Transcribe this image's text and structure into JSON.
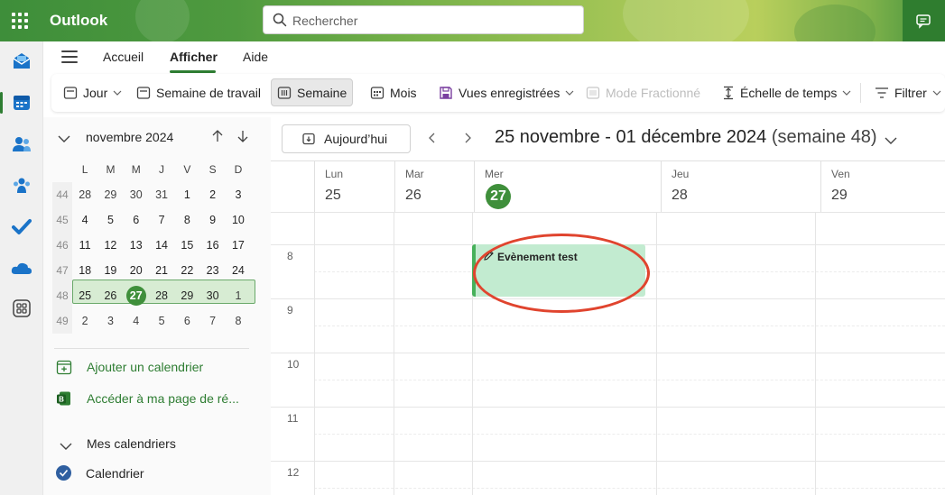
{
  "header": {
    "app_title": "Outlook",
    "search_placeholder": "Rechercher"
  },
  "nav_tabs": [
    {
      "label": "Accueil",
      "active": false
    },
    {
      "label": "Afficher",
      "active": true
    },
    {
      "label": "Aide",
      "active": false
    }
  ],
  "ribbon": {
    "day": "Jour",
    "work_week": "Semaine de travail",
    "week": "Semaine",
    "month": "Mois",
    "saved_views": "Vues enregistrées",
    "split_mode": "Mode Fractionné",
    "time_scale": "Échelle de temps",
    "filter": "Filtrer"
  },
  "mini_calendar": {
    "month_label": "novembre 2024",
    "weekday_headers": [
      "L",
      "M",
      "M",
      "J",
      "V",
      "S",
      "D"
    ],
    "weeks": [
      {
        "wk": "44",
        "days": [
          "28",
          "29",
          "30",
          "31",
          "1",
          "2",
          "3"
        ]
      },
      {
        "wk": "45",
        "days": [
          "4",
          "5",
          "6",
          "7",
          "8",
          "9",
          "10"
        ]
      },
      {
        "wk": "46",
        "days": [
          "11",
          "12",
          "13",
          "14",
          "15",
          "16",
          "17"
        ]
      },
      {
        "wk": "47",
        "days": [
          "18",
          "19",
          "20",
          "21",
          "22",
          "23",
          "24"
        ]
      },
      {
        "wk": "48",
        "days": [
          "25",
          "26",
          "27",
          "28",
          "29",
          "30",
          "1"
        ]
      },
      {
        "wk": "49",
        "days": [
          "2",
          "3",
          "4",
          "5",
          "6",
          "7",
          "8"
        ]
      }
    ],
    "today": "27",
    "add_calendar": "Ajouter un calendrier",
    "booking_page": "Accéder à ma page de ré...",
    "my_calendars": "Mes calendriers",
    "calendar_name": "Calendrier"
  },
  "main": {
    "today_button": "Aujourd’hui",
    "date_range": "25 novembre - 01 décembre 2024",
    "week_label": "(semaine 48)",
    "days": [
      {
        "name": "Lun",
        "date": "25"
      },
      {
        "name": "Mar",
        "date": "26"
      },
      {
        "name": "Mer",
        "date": "27",
        "today": true
      },
      {
        "name": "Jeu",
        "date": "28"
      },
      {
        "name": "Ven",
        "date": "29"
      }
    ],
    "hours": [
      "8",
      "9",
      "10",
      "11",
      "12"
    ],
    "event": {
      "title": "Evènement test",
      "day": "Mer",
      "start_hour": "8",
      "color": "#c2ebd0"
    }
  },
  "colors": {
    "accent": "#2e7d32",
    "today_circle": "#3f8f3b",
    "event_bar": "#47b15b",
    "annotation": "#e0442e"
  }
}
